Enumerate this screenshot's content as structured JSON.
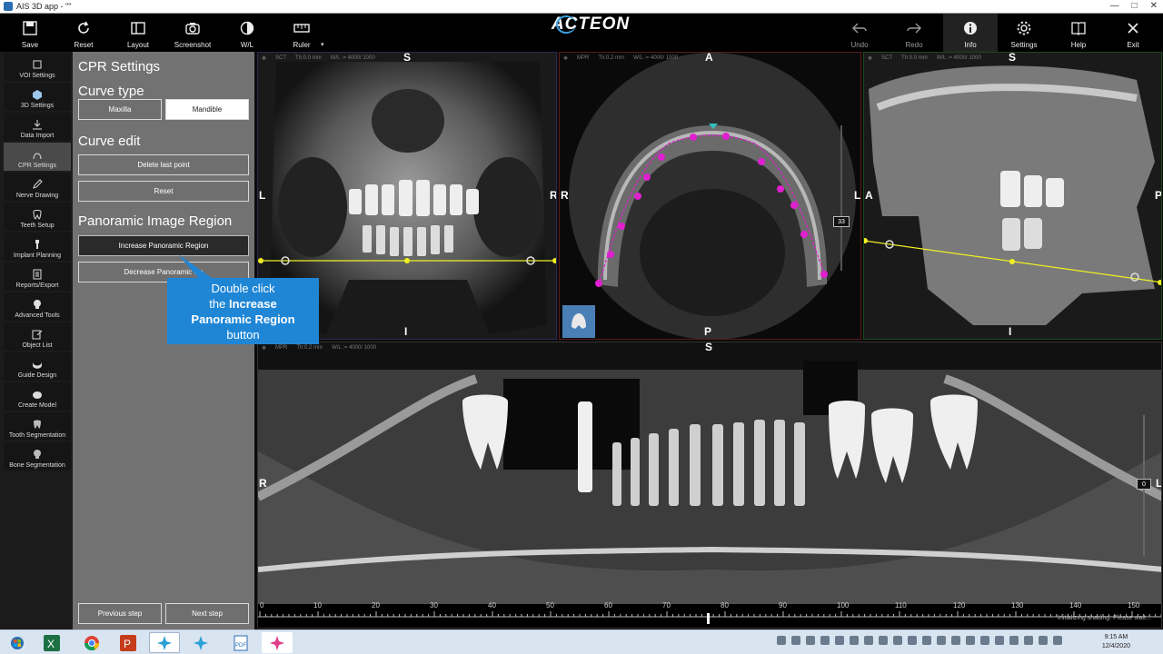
{
  "window": {
    "title": "AIS 3D app - \"\""
  },
  "toolbar": {
    "left": [
      {
        "label": "Save",
        "icon": "save-icon"
      },
      {
        "label": "Reset",
        "icon": "reset-icon"
      },
      {
        "label": "Layout",
        "icon": "layout-icon"
      },
      {
        "label": "Screenshot",
        "icon": "camera-icon"
      },
      {
        "label": "W/L",
        "icon": "contrast-icon"
      },
      {
        "label": "Ruler",
        "icon": "ruler-icon"
      }
    ],
    "logo": "ACTEON",
    "right": [
      {
        "label": "Undo",
        "icon": "undo-icon"
      },
      {
        "label": "Redo",
        "icon": "redo-icon"
      },
      {
        "label": "Info",
        "icon": "info-icon"
      },
      {
        "label": "Settings",
        "icon": "gear-icon"
      },
      {
        "label": "Help",
        "icon": "book-icon"
      },
      {
        "label": "Exit",
        "icon": "close-icon"
      }
    ]
  },
  "nav": [
    {
      "label": "VOI Settings",
      "icon": "cube-icon"
    },
    {
      "label": "3D Settings",
      "icon": "cube-3d-icon"
    },
    {
      "label": "Data Import",
      "icon": "download-icon"
    },
    {
      "label": "CPR Settings",
      "icon": "curve-icon",
      "active": true
    },
    {
      "label": "Nerve Drawing",
      "icon": "pen-icon"
    },
    {
      "label": "Teeth Setup",
      "icon": "tooth-icon"
    },
    {
      "label": "Implant Planning",
      "icon": "implant-icon"
    },
    {
      "label": "Reports/Export",
      "icon": "report-icon"
    },
    {
      "label": "Advanced Tools",
      "icon": "skull-icon"
    },
    {
      "label": "Object List",
      "icon": "edit-icon"
    },
    {
      "label": "Guide Design",
      "icon": "guide-icon"
    },
    {
      "label": "Create Model",
      "icon": "model-icon"
    },
    {
      "label": "Tooth Segmentation",
      "icon": "tooth-seg-icon"
    },
    {
      "label": "Bone Segmentation",
      "icon": "bone-seg-icon"
    }
  ],
  "panel": {
    "title": "CPR Settings",
    "curve_type": {
      "heading": "Curve type",
      "maxilla": "Maxilla",
      "mandible": "Mandible"
    },
    "curve_edit": {
      "heading": "Curve edit",
      "delete_last": "Delete last point",
      "reset": "Reset"
    },
    "pano": {
      "heading": "Panoramic Image Region",
      "increase": "Increase Panoramic Region",
      "decrease": "Decrease Panoramic Re"
    },
    "prev": "Previous step",
    "next": "Next step"
  },
  "callout": {
    "line1": "Double click",
    "line2a": "the ",
    "line2b": "Increase",
    "line3": "Panoramic Region",
    "line4": "button"
  },
  "views": {
    "coronal": {
      "mode": "SCT",
      "th": "Th:0.0 mm",
      "wl": "W/L := 4000/ 1000",
      "top": "S",
      "left": "L",
      "right": "R",
      "bottom": "I"
    },
    "axial": {
      "mode": "MPR",
      "th": "Th:0.2 mm",
      "wl": "W/L := 4000/ 1000",
      "top": "A",
      "left": "R",
      "right": "L",
      "bottom": "P",
      "slider": "33"
    },
    "sagittal": {
      "mode": "SCT",
      "th": "Th:0.0 mm",
      "wl": "W/L := 4000/ 1000",
      "top": "S",
      "left": "A",
      "right": "P",
      "bottom": "I"
    },
    "pano": {
      "mode": "MPR",
      "th": "Th:0.2 mm",
      "wl": "W/L := 4000/ 1000",
      "top": "S",
      "left": "R",
      "right": "L",
      "slider": "0",
      "status": "Initializing shading. Please wait..."
    }
  },
  "ruler": {
    "ticks": [
      "0",
      "10",
      "20",
      "30",
      "40",
      "50",
      "60",
      "70",
      "80",
      "90",
      "100",
      "110",
      "120",
      "130",
      "140",
      "150"
    ]
  },
  "colors": {
    "accent": "#1f86d6",
    "curve": "#e020d0",
    "guide": "#f0f020"
  },
  "taskbar": {
    "time": "9:15 AM",
    "date": "12/4/2020"
  }
}
